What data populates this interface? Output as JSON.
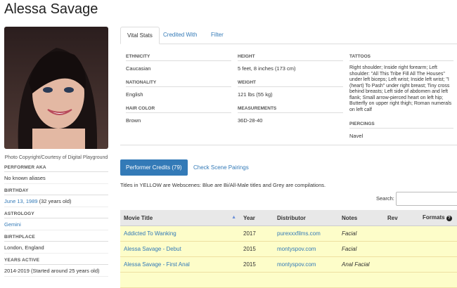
{
  "performer_name": "Alessa Savage",
  "photo_caption": "Photo Copyright/Courtesy of Digital Playground",
  "sidebar": [
    {
      "label": "PERFORMER AKA",
      "value": "No known aliases"
    },
    {
      "label": "BIRTHDAY",
      "value": "June 13, 1989",
      "extra": "(32 years old)"
    },
    {
      "label": "ASTROLOGY",
      "value": "Gemini"
    },
    {
      "label": "BIRTHPLACE",
      "value": "London, England"
    },
    {
      "label": "YEARS ACTIVE",
      "value": "2014-2019 (Started around 25 years old)"
    }
  ],
  "tabs": [
    "Vital Stats",
    "Credited With",
    "Filter"
  ],
  "stats": {
    "ethnicity_label": "ETHNICITY",
    "ethnicity": "Caucasian",
    "nationality_label": "NATIONALITY",
    "nationality": "English",
    "haircolor_label": "HAIR COLOR",
    "haircolor": "Brown",
    "height_label": "HEIGHT",
    "height": "5 feet, 8 inches (173 cm)",
    "weight_label": "WEIGHT",
    "weight": "121 lbs (55 kg)",
    "measurements_label": "MEASUREMENTS",
    "measurements": "36D-28-40",
    "tattoos_label": "TATTOOS",
    "tattoos": "Right shoulder; Inside right forearm; Left shoulder: \"All This Tribe Fill All The Houses\" under left biceps; Left wrist; Inside left wrist; \"I (heart) To Pash\" under right breast; Tiny cross behind breasts; Left side of abdomen and left flank; Small arrow-pierced heart on left hip; Butterfly on upper right thigh; Roman numerals on left calf",
    "piercings_label": "PIERCINGS",
    "piercings": "Navel"
  },
  "credits_button": "Performer Credits (79)",
  "pairings_link": "Check Scene Pairings",
  "legend_note": "Titles in YELLOW are Webscenes: Blue are Bi/All-Male titles and Grey are compilations.",
  "search_label": "Search:",
  "table": {
    "headers": [
      "Movie Title",
      "Year",
      "Distributor",
      "Notes",
      "Rev",
      "Formats"
    ],
    "rows": [
      {
        "title": "Addicted To Wanking",
        "year": "2017",
        "distributor": "purexxxfilms.com",
        "notes": "Facial"
      },
      {
        "title": "Alessa Savage - Debut",
        "year": "2015",
        "distributor": "montyspov.com",
        "notes": "Facial"
      },
      {
        "title": "Alessa Savage - First Anal",
        "year": "2015",
        "distributor": "montyspov.com",
        "notes": "Anal Facial"
      },
      {
        "title": "",
        "year": "",
        "distributor": "",
        "notes": ""
      }
    ]
  },
  "colors": {
    "accent": "#337ab7",
    "webscene_row": "#fdfdc9"
  }
}
